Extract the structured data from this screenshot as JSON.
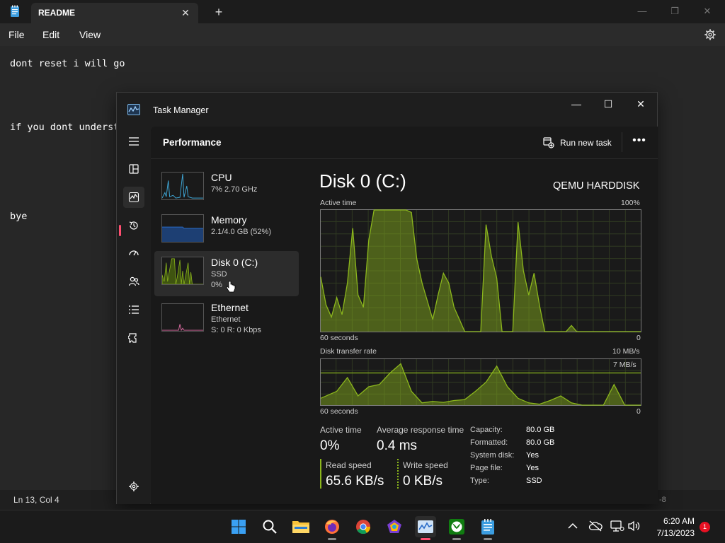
{
  "notepad": {
    "tab_title": "README",
    "tab_close": "✕",
    "new_tab": "+",
    "menus": [
      "File",
      "Edit",
      "View"
    ],
    "lines": [
      "dont reset i will go",
      "if you dont underst",
      "bye"
    ],
    "status_position": "Ln 13, Col 4",
    "status_right_fragment": "-8"
  },
  "task_manager": {
    "title": "Task Manager",
    "section_title": "Performance",
    "run_new_task": "Run new task",
    "more": "•••",
    "resources": [
      {
        "name": "CPU",
        "line1": "7%  2.70 GHz",
        "line2": ""
      },
      {
        "name": "Memory",
        "line1": "2.1/4.0 GB (52%)",
        "line2": ""
      },
      {
        "name": "Disk 0 (C:)",
        "line1": "SSD",
        "line2": "0%"
      },
      {
        "name": "Ethernet",
        "line1": "Ethernet",
        "line2": "S: 0  R: 0 Kbps"
      }
    ],
    "detail": {
      "title": "Disk 0 (C:)",
      "model": "QEMU HARDDISK",
      "active_time_chart": {
        "label": "Active time",
        "max_label": "100%",
        "x_left": "60 seconds",
        "x_right": "0"
      },
      "transfer_chart": {
        "label": "Disk transfer rate",
        "max_label": "10 MB/s",
        "line_label": "7 MB/s",
        "x_left": "60 seconds",
        "x_right": "0"
      },
      "stats": {
        "active_time_label": "Active time",
        "active_time_value": "0%",
        "avg_response_label": "Average response time",
        "avg_response_value": "0.4 ms",
        "read_speed_label": "Read speed",
        "read_speed_value": "65.6 KB/s",
        "write_speed_label": "Write speed",
        "write_speed_value": "0 KB/s"
      },
      "properties": [
        {
          "key": "Capacity:",
          "value": "80.0 GB"
        },
        {
          "key": "Formatted:",
          "value": "80.0 GB"
        },
        {
          "key": "System disk:",
          "value": "Yes"
        },
        {
          "key": "Page file:",
          "value": "Yes"
        },
        {
          "key": "Type:",
          "value": "SSD"
        }
      ]
    }
  },
  "chart_data": [
    {
      "type": "area",
      "title": "Active time",
      "ylim": [
        0,
        100
      ],
      "x": [
        60,
        59,
        58,
        57,
        56,
        55,
        54,
        53,
        52,
        51,
        50,
        49,
        48,
        47,
        46,
        45,
        44,
        43,
        42,
        41,
        40,
        39,
        38,
        37,
        36,
        35,
        34,
        33,
        32,
        31,
        30,
        29,
        28,
        27,
        26,
        25,
        24,
        23,
        22,
        21,
        20,
        19,
        18,
        17,
        16,
        15,
        14,
        13,
        12,
        11,
        10,
        9,
        8,
        7,
        6,
        5,
        4,
        3,
        2,
        1,
        0
      ],
      "values": [
        45,
        22,
        12,
        28,
        14,
        40,
        85,
        30,
        20,
        75,
        100,
        100,
        100,
        100,
        100,
        100,
        100,
        98,
        60,
        40,
        25,
        10,
        30,
        48,
        40,
        20,
        10,
        0,
        0,
        0,
        0,
        88,
        62,
        44,
        0,
        0,
        0,
        90,
        50,
        30,
        48,
        22,
        0,
        0,
        0,
        0,
        0,
        5,
        0,
        0,
        0,
        0,
        0,
        0,
        0,
        0,
        0,
        0,
        0,
        0,
        0
      ]
    },
    {
      "type": "area",
      "title": "Disk transfer rate",
      "ylim": [
        0,
        10
      ],
      "x": [
        60,
        57,
        55,
        53,
        51,
        49,
        47,
        45,
        43,
        41,
        39,
        37,
        35,
        33,
        31,
        29,
        27,
        25,
        23,
        21,
        19,
        17,
        15,
        13,
        11,
        9,
        7,
        5,
        3,
        1,
        0
      ],
      "values": [
        1.5,
        3,
        6,
        2,
        4,
        4.5,
        7,
        9,
        3,
        0.5,
        0.8,
        0.6,
        1,
        1.2,
        3,
        5,
        8.5,
        4,
        1.5,
        0.5,
        0.2,
        1,
        2,
        0.5,
        0,
        0,
        0,
        4.5,
        0,
        0,
        0
      ]
    }
  ],
  "taskbar": {
    "clock_time": "6:20 AM",
    "clock_date": "7/13/2023",
    "notification_count": "1",
    "apps": [
      "start-icon",
      "search-icon",
      "file-explorer-icon",
      "firefox-icon",
      "chrome-icon",
      "app-icon",
      "task-manager-icon",
      "xbox-icon",
      "notepad-icon"
    ]
  },
  "colors": {
    "disk_green": "#8bb61c",
    "cpu_blue": "#3fa7d6",
    "memory_blue": "#2a6cc7",
    "ethernet_pink": "#d86aa0"
  }
}
